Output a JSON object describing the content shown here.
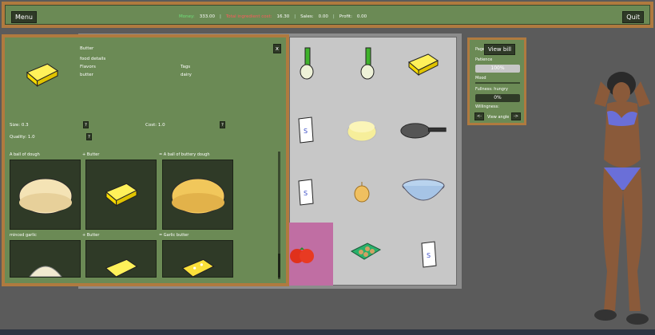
{
  "topbar": {
    "menu": "Menu",
    "quit": "Quit",
    "money_label": "Money:",
    "money_value": "333.00",
    "cost_label": "Total ingredient cost:",
    "cost_value": "16.30",
    "sales_label": "Sales:",
    "sales_value": "0.00",
    "profit_label": "Profit:",
    "profit_value": "0.00",
    "sep": "|"
  },
  "details": {
    "name": "Butter",
    "food_details": "food details",
    "flavors_label": "Flavors",
    "flavors_value": "butter",
    "tags_label": "Tags",
    "tags_value": "dairy",
    "size_label": "Size: 0.3",
    "cost_label": "Cost: 1.0",
    "quality_label": "Quality: 1.0",
    "help": "?",
    "close": "x"
  },
  "recipes": [
    {
      "label": "A ball of dough"
    },
    {
      "label": "+ Butter"
    },
    {
      "label": "= A ball of buttery dough"
    },
    {
      "label": "minced garlic"
    },
    {
      "label": "+ Butter"
    },
    {
      "label": "= Garlic butter"
    }
  ],
  "status": {
    "page_label": "Page",
    "view_bill": "View bill",
    "patience_label": "Patience",
    "patience_value": "100%",
    "patience_level": 1.0,
    "mood_label": "Mood",
    "fullness_label": "Fullness: hungry",
    "fullness_value": "0%",
    "fullness_level": 0,
    "willingness_label": "Willingness:",
    "prev": "<-",
    "next": "->",
    "view_angle": "View angle"
  },
  "colors": {
    "money": "#6fe07a",
    "cost": "#ff5a5a",
    "frame": "#b07a3f",
    "panel": "#6b8a55",
    "card": "#2f3a27",
    "pink": "#c06ea3"
  },
  "icons": [
    "butter-icon",
    "spring-onion-icon",
    "flour-bag-icon",
    "cheese-icon",
    "frying-pan-icon",
    "onion-icon",
    "bowl-icon",
    "tomato-icon",
    "egg-carton-icon",
    "dough-icon",
    "garlic-icon",
    "garlic-butter-icon"
  ]
}
